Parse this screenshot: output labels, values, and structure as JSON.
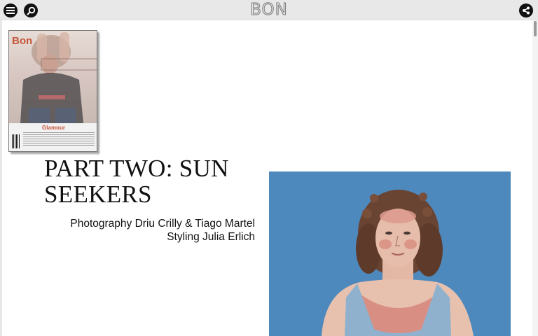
{
  "header": {
    "logo": "BON",
    "menu_icon": "hamburger-menu-icon",
    "search_icon": "search-icon",
    "share_icon": "share-icon"
  },
  "cover": {
    "brand": "Bon",
    "headline": "Glamour"
  },
  "article": {
    "title": "PART TWO: SUN SEEKERS",
    "credits": [
      "Photography Driu Crilly & Tiago Martel",
      "Styling Julia Erlich"
    ]
  },
  "colors": {
    "topbar": "#e8e8e8",
    "photo_background": "#4d89bd",
    "cover_accent": "#c4573a"
  }
}
